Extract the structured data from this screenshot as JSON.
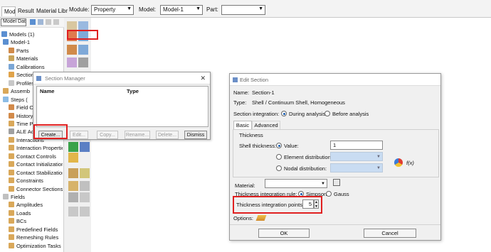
{
  "menu_tabs": [
    "Model",
    "Results",
    "Material Libr"
  ],
  "context": {
    "module_label": "Module:",
    "module_value": "Property",
    "model_label": "Model:",
    "model_value": "Model-1",
    "part_label": "Part:",
    "part_value": ""
  },
  "tree": {
    "selector": "Model Dat",
    "items": [
      "Models (1)",
      "Model-1",
      "Parts",
      "Materials",
      "Calibrations",
      "Section",
      "Profiles",
      "Assemb",
      "Steps (",
      "Field O",
      "History",
      "Time P",
      "ALE Ad",
      "Interactions",
      "Interaction Properties",
      "Contact Controls",
      "Contact Initialization",
      "Contact Stabilization",
      "Constraints",
      "Connector Sections",
      "Fields",
      "Amplitudes",
      "Loads",
      "BCs",
      "Predefined Fields",
      "Remeshing Rules",
      "Optimization Tasks"
    ]
  },
  "section_manager": {
    "title": "Section Manager",
    "col_name": "Name",
    "col_type": "Type",
    "buttons": [
      "Create...",
      "Edit...",
      "Copy...",
      "Rename...",
      "Delete...",
      "Dismiss"
    ]
  },
  "edit_section": {
    "title": "Edit Section",
    "name_label": "Name:",
    "name_value": "Section-1",
    "type_label": "Type:",
    "type_value": "Shell / Continuum Shell, Homogeneous",
    "integration_label": "Section integration:",
    "integration_options": [
      "During analysis",
      "Before analysis"
    ],
    "tabs": [
      "Basic",
      "Advanced"
    ],
    "thickness_group": "Thickness",
    "shell_thickness_label": "Shell thickness:",
    "value_label": "Value:",
    "value": "1",
    "element_distribution_label": "Element distribution:",
    "nodal_distribution_label": "Nodal distribution:",
    "fx_label": "f(x)",
    "material_label": "Material:",
    "material_value": "",
    "rule_label": "Thickness integration rule:",
    "rule_options": [
      "Simpson",
      "Gauss"
    ],
    "points_label": "Thickness integration points:",
    "points_value": "5",
    "options_label": "Options:",
    "ok": "OK",
    "cancel": "Cancel"
  }
}
